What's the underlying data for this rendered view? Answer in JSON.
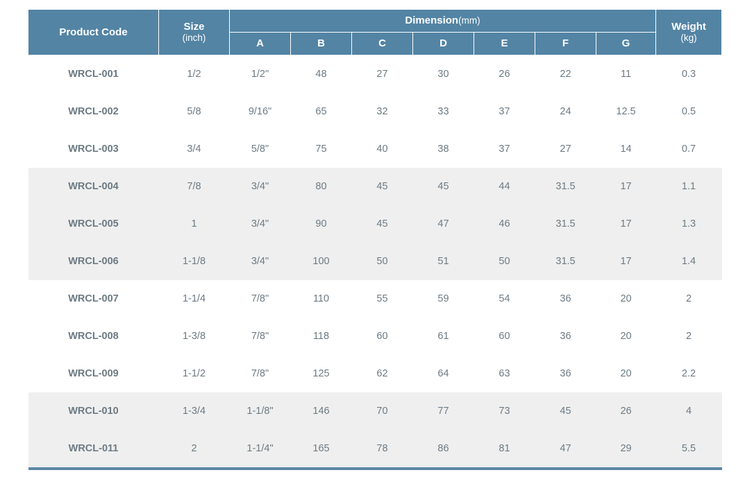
{
  "table": {
    "header": {
      "product_code": "Product Code",
      "size_main": "Size",
      "size_unit": "(inch)",
      "dimension_main": "Dimension",
      "dimension_unit": "(mm)",
      "weight_main": "Weight",
      "weight_unit": "(kg)",
      "sub_columns": [
        "A",
        "B",
        "C",
        "D",
        "E",
        "F",
        "G"
      ]
    },
    "colors": {
      "header_background": "#5384a4",
      "header_text": "#ffffff",
      "row_shaded_background": "#efefef",
      "row_plain_background": "#ffffff",
      "body_text": "#6c7a83",
      "divider_line": "#d2d2d2",
      "bottom_border": "#5b87a5"
    },
    "rows": [
      {
        "product_code": "WRCL-001",
        "size": "1/2",
        "a": "1/2\"",
        "b": "48",
        "c": "27",
        "d": "30",
        "e": "26",
        "f": "22",
        "g": "11",
        "weight": "0.3",
        "shaded": false
      },
      {
        "product_code": "WRCL-002",
        "size": "5/8",
        "a": "9/16\"",
        "b": "65",
        "c": "32",
        "d": "33",
        "e": "37",
        "f": "24",
        "g": "12.5",
        "weight": "0.5",
        "shaded": false
      },
      {
        "product_code": "WRCL-003",
        "size": "3/4",
        "a": "5/8\"",
        "b": "75",
        "c": "40",
        "d": "38",
        "e": "37",
        "f": "27",
        "g": "14",
        "weight": "0.7",
        "shaded": false
      },
      {
        "product_code": "WRCL-004",
        "size": "7/8",
        "a": "3/4\"",
        "b": "80",
        "c": "45",
        "d": "45",
        "e": "44",
        "f": "31.5",
        "g": "17",
        "weight": "1.1",
        "shaded": true
      },
      {
        "product_code": "WRCL-005",
        "size": "1",
        "a": "3/4\"",
        "b": "90",
        "c": "45",
        "d": "47",
        "e": "46",
        "f": "31.5",
        "g": "17",
        "weight": "1.3",
        "shaded": true
      },
      {
        "product_code": "WRCL-006",
        "size": "1-1/8",
        "a": "3/4\"",
        "b": "100",
        "c": "50",
        "d": "51",
        "e": "50",
        "f": "31.5",
        "g": "17",
        "weight": "1.4",
        "shaded": true
      },
      {
        "product_code": "WRCL-007",
        "size": "1-1/4",
        "a": "7/8\"",
        "b": "110",
        "c": "55",
        "d": "59",
        "e": "54",
        "f": "36",
        "g": "20",
        "weight": "2",
        "shaded": false
      },
      {
        "product_code": "WRCL-008",
        "size": "1-3/8",
        "a": "7/8\"",
        "b": "118",
        "c": "60",
        "d": "61",
        "e": "60",
        "f": "36",
        "g": "20",
        "weight": "2",
        "shaded": false
      },
      {
        "product_code": "WRCL-009",
        "size": "1-1/2",
        "a": "7/8\"",
        "b": "125",
        "c": "62",
        "d": "64",
        "e": "63",
        "f": "36",
        "g": "20",
        "weight": "2.2",
        "shaded": false
      },
      {
        "product_code": "WRCL-010",
        "size": "1-3/4",
        "a": "1-1/8\"",
        "b": "146",
        "c": "70",
        "d": "77",
        "e": "73",
        "f": "45",
        "g": "26",
        "weight": "4",
        "shaded": true
      },
      {
        "product_code": "WRCL-011",
        "size": "2",
        "a": "1-1/4\"",
        "b": "165",
        "c": "78",
        "d": "86",
        "e": "81",
        "f": "47",
        "g": "29",
        "weight": "5.5",
        "shaded": true
      }
    ]
  }
}
